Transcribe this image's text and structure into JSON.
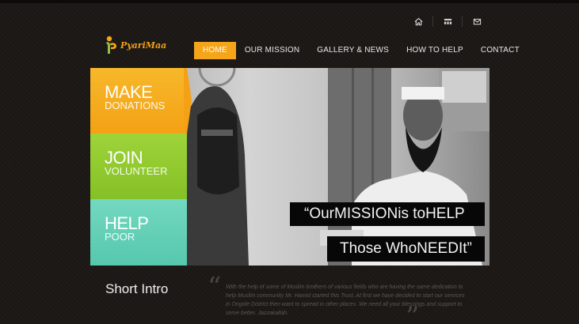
{
  "brand": {
    "name": "PyariMaa",
    "accent": "#f5a51a"
  },
  "top_icons": [
    "home-icon",
    "sitemap-icon",
    "mail-icon"
  ],
  "nav": {
    "items": [
      {
        "label": "HOME",
        "active": true
      },
      {
        "label": "OUR MISSION",
        "active": false
      },
      {
        "label": "GALLERY & NEWS",
        "active": false
      },
      {
        "label": "HOW TO HELP",
        "active": false
      },
      {
        "label": "CONTACT",
        "active": false
      }
    ]
  },
  "hero": {
    "cta": [
      {
        "big": "MAKE",
        "small": "DONATIONS",
        "color": "#f5a51a"
      },
      {
        "big": "JOIN",
        "small": "VOLUNTEER",
        "color": "#8cc63f"
      },
      {
        "big": "HELP",
        "small": "POOR",
        "color": "#62cfb4"
      }
    ],
    "tagline_1": "“OurMISSIONis toHELP",
    "tagline_2": "Those WhoNEEDIt”"
  },
  "intro": {
    "title": "Short Intro",
    "text": "With the help of some of Muslim brothers of various fields who are having the same dedication to help Muslim community Mr. Hamid started this Trust. At first we have decided to start our services in Ongole District then want to spread in other places. We need all your blessings and support to serve better. Jazzakallah."
  }
}
